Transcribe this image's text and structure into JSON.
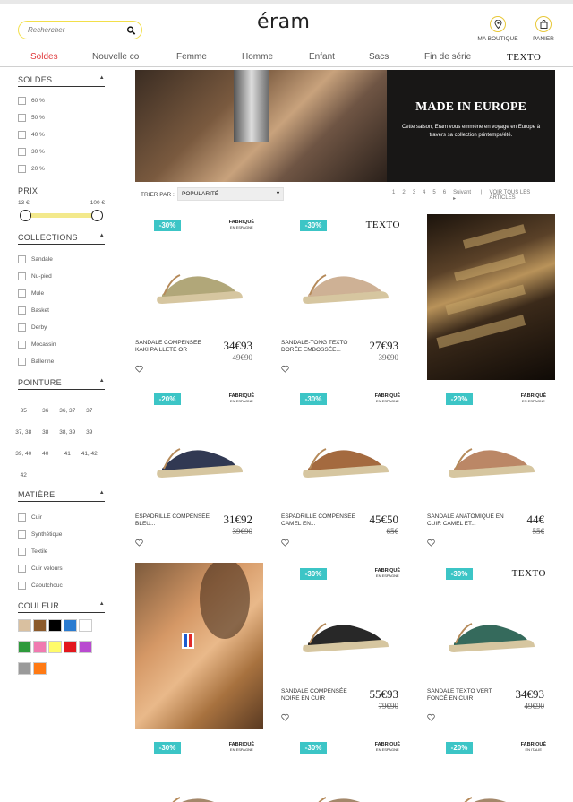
{
  "header": {
    "search_placeholder": "Rechercher",
    "logo": "éram",
    "store_label": "MA BOUTIQUE",
    "cart_label": "PANIER"
  },
  "nav": [
    "Soldes",
    "Nouvelle co",
    "Femme",
    "Homme",
    "Enfant",
    "Sacs",
    "Fin de série",
    "TEXTO"
  ],
  "sidebar": {
    "soldes": {
      "title": "SOLDES",
      "items": [
        "60 %",
        "50 %",
        "40 %",
        "30 %",
        "20 %"
      ]
    },
    "prix": {
      "title": "PRIX",
      "min": "13 €",
      "max": "100 €"
    },
    "collections": {
      "title": "COLLECTIONS",
      "items": [
        "Sandale",
        "Nu-pied",
        "Mule",
        "Basket",
        "Derby",
        "Mocassin",
        "Ballerine"
      ]
    },
    "pointure": {
      "title": "POINTURE",
      "items": [
        "35",
        "36",
        "36, 37",
        "37",
        "37, 38",
        "38",
        "38, 39",
        "39",
        "39, 40",
        "40",
        "41",
        "41, 42",
        "42"
      ]
    },
    "matiere": {
      "title": "MATIÈRE",
      "items": [
        "Cuir",
        "Synthétique",
        "Textile",
        "Cuir velours",
        "Caoutchouc"
      ]
    },
    "couleur": {
      "title": "COULEUR",
      "swatches": [
        "#d9c0a0",
        "#8b5a2b",
        "#000000",
        "#2a7bd0",
        "#ffffff",
        "#2e9a3c",
        "#f07ab0",
        "#fffb6a",
        "#e3171d",
        "#b94ad0",
        "#9a9a9a",
        "#ff7a14"
      ]
    }
  },
  "banner": {
    "title": "MADE IN EUROPE",
    "text": "Cette saison, Eram vous emmène en voyage en Europe à travers sa collection printemps/été."
  },
  "sort": {
    "label": "TRIER PAR :",
    "value": "POPULARITÉ",
    "pages": [
      "1",
      "2",
      "3",
      "4",
      "5",
      "6"
    ],
    "next": "Suivant",
    "all": "VOIR TOUS LES ARTICLES"
  },
  "products": [
    {
      "badge": "-30%",
      "tag": "FABRIQUÉ",
      "tag_sub": "EN ESPAGNE",
      "name": "SANDALE COMPENSEE KAKI PAILLETÉ OR",
      "price": "34€93",
      "old": "49€90",
      "color": "#a89d6a"
    },
    {
      "badge": "-30%",
      "brand": "TEXTO",
      "name": "SANDALE-TONG TEXTO DORÉE EMBOSSÉE...",
      "price": "27€93",
      "old": "39€90",
      "color": "#c9a98a"
    },
    {
      "badge": "-20%",
      "tag": "FABRIQUÉ",
      "tag_sub": "EN ESPAGNE",
      "name": "ESPADRILLE COMPENSÉE BLEU...",
      "price": "31€92",
      "old": "39€90",
      "color": "#1b2440"
    },
    {
      "badge": "-30%",
      "tag": "FABRIQUÉ",
      "tag_sub": "EN ESPAGNE",
      "name": "ESPADRILLE COMPENSÉE CAMEL EN...",
      "price": "45€50",
      "old": "65€",
      "color": "#9a5a2a"
    },
    {
      "badge": "-20%",
      "tag": "FABRIQUÉ",
      "tag_sub": "EN ESPAGNE",
      "name": "SANDALE ANATOMIQUE EN CUIR CAMEL ET...",
      "price": "44€",
      "old": "55€",
      "color": "#b47a55"
    },
    {
      "badge": "-30%",
      "tag": "FABRIQUÉ",
      "tag_sub": "EN ESPAGNE",
      "name": "SANDALE COMPENSÉE NOIRE EN CUIR",
      "price": "55€93",
      "old": "79€90",
      "color": "#111111"
    },
    {
      "badge": "-30%",
      "brand": "TEXTO",
      "name": "SANDALE TEXTO VERT FONCÉ EN CUIR",
      "price": "34€93",
      "old": "49€90",
      "color": "#1f5a4a"
    },
    {
      "badge": "-30%",
      "tag": "FABRIQUÉ",
      "tag_sub": "EN ESPAGNE"
    },
    {
      "badge": "-30%",
      "tag": "FABRIQUÉ",
      "tag_sub": "EN ESPAGNE"
    },
    {
      "badge": "-20%",
      "tag": "FABRIQUÉ",
      "tag_sub": "EN ITALIE"
    }
  ]
}
